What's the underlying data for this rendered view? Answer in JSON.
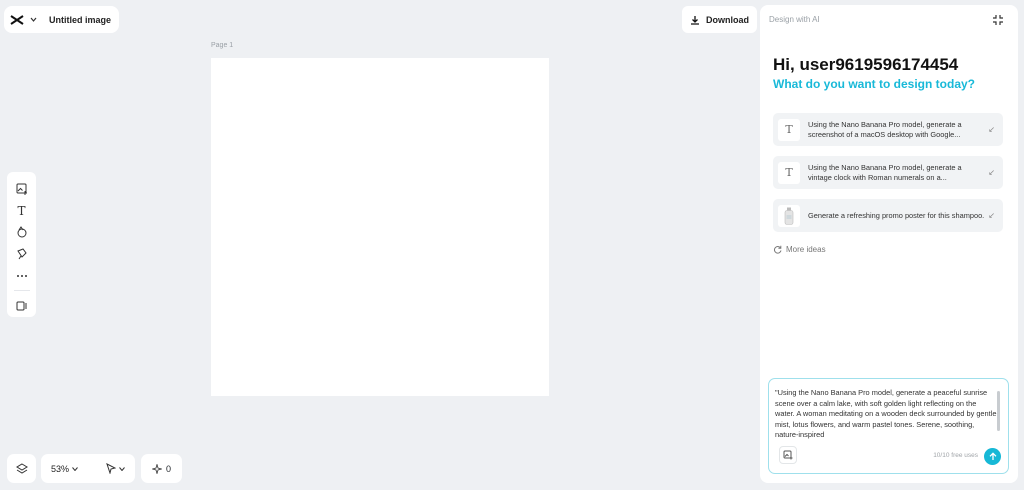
{
  "topbar": {
    "title": "Untitled image"
  },
  "download": {
    "label": "Download"
  },
  "canvas": {
    "page_label": "Page 1"
  },
  "bottom_bar": {
    "zoom": "53%",
    "credits": "0"
  },
  "panel": {
    "header": "Design with AI",
    "greeting": "Hi, user9619596174454",
    "subheading": "What do you want to design today?",
    "suggestions": [
      {
        "icon": "text-icon",
        "text": "Using the Nano Banana Pro model, generate a screenshot of a macOS desktop with Google..."
      },
      {
        "icon": "text-icon",
        "text": "Using the Nano Banana Pro model, generate a vintage clock with Roman numerals on a..."
      },
      {
        "icon": "shampoo-thumbnail",
        "text": "Generate a refreshing promo poster for this shampoo."
      }
    ],
    "more_ideas": "More ideas",
    "prompt": {
      "value": "\"Using the Nano Banana Pro model, generate a peaceful sunrise scene over a calm lake, with soft golden light reflecting on the water. A woman meditating on a wooden deck surrounded by gentle mist, lotus flowers, and warm pastel tones. Serene, soothing, nature-inspired",
      "free_uses": "10/10 free uses"
    }
  },
  "colors": {
    "accent": "#16b8d6",
    "canvas_bg": "#eef0f3"
  }
}
